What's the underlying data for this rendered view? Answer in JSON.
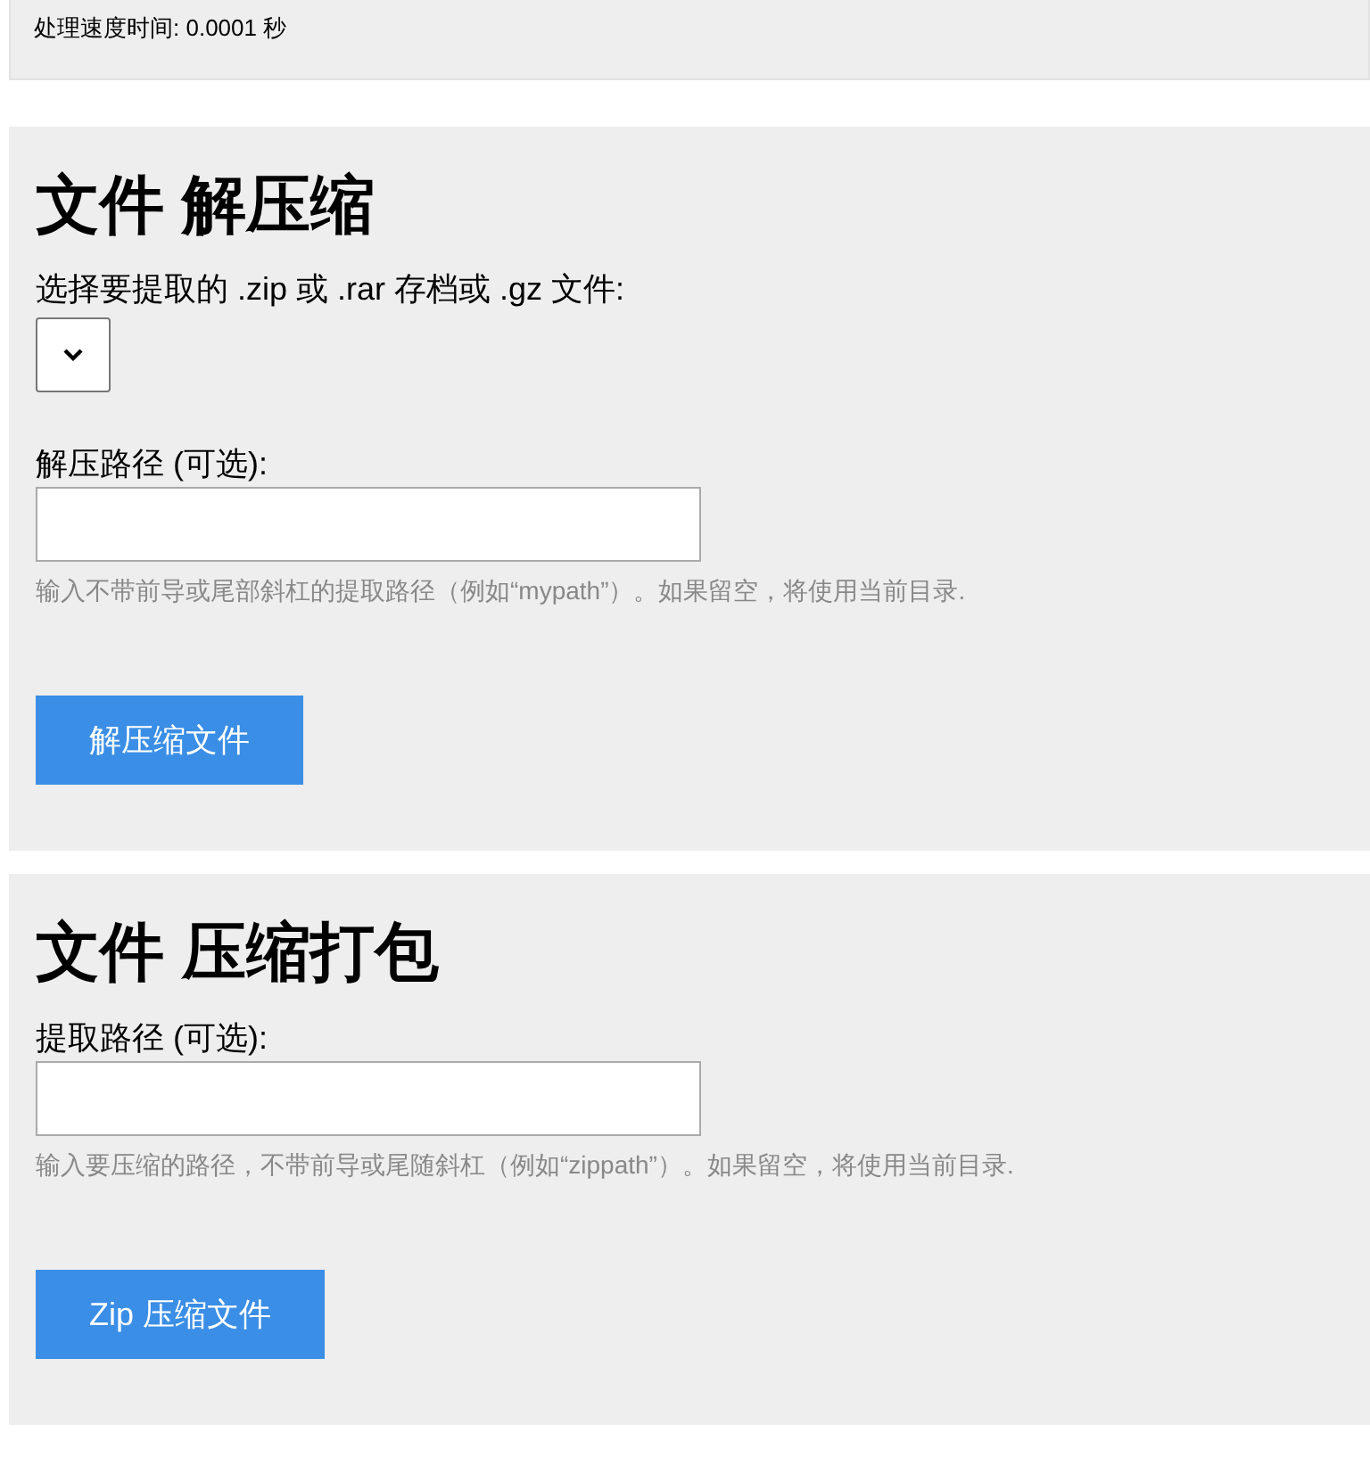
{
  "status": "处理速度时间: 0.0001 秒",
  "sections": [
    {
      "title": "文件 解压缩",
      "fields": [
        {
          "kind": "select",
          "label": "选择要提取的 .zip 或 .rar 存档或 .gz 文件:"
        },
        {
          "kind": "text",
          "label": "解压路径 (可选):",
          "help": "输入不带前导或尾部斜杠的提取路径（例如“mypath”）。如果留空，将使用当前目录."
        }
      ],
      "button": "解压缩文件"
    },
    {
      "title": "文件 压缩打包",
      "fields": [
        {
          "kind": "text",
          "label": "提取路径 (可选):",
          "help": "输入要压缩的路径，不带前导或尾随斜杠（例如“zippath”）。如果留空，将使用当前目录."
        }
      ],
      "button": "Zip 压缩文件"
    }
  ]
}
